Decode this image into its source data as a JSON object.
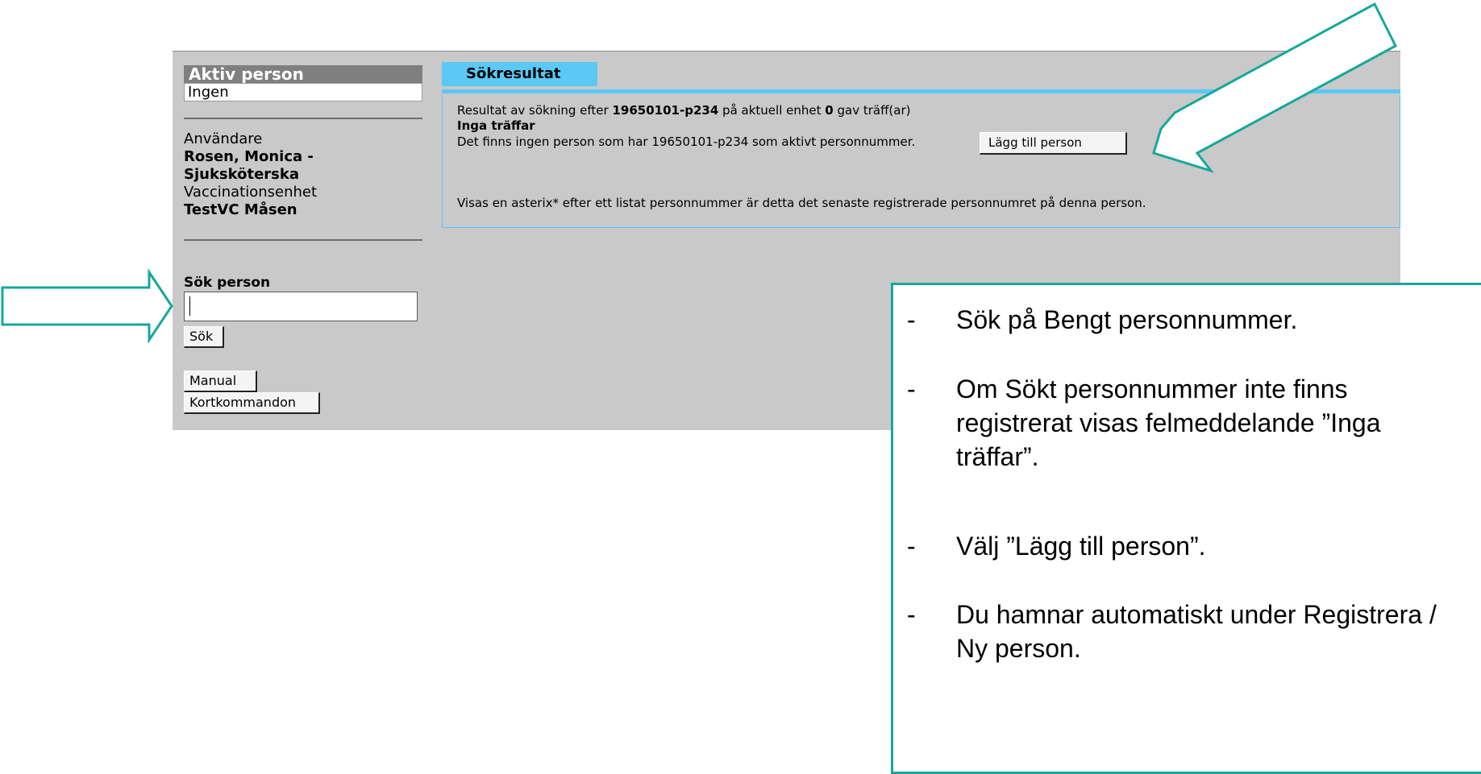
{
  "sidebar": {
    "active_header": "Aktiv person",
    "active_value": "Ingen",
    "user_label": "Användare",
    "user_name": "Rosen, Monica -",
    "user_role": "Sjuksköterska",
    "unit_label": "Vaccinationsenhet",
    "unit_name": "TestVC Måsen",
    "search_label": "Sök person",
    "search_value": "",
    "search_button": "Sök",
    "manual_button": "Manual",
    "shortcuts_button": "Kortkommandon"
  },
  "main": {
    "tab": "Sökresultat",
    "result_prefix": "Resultat av sökning efter",
    "query": "19650101-p234",
    "result_middle": "på aktuell enhet",
    "count": "0",
    "result_suffix": "gav träff(ar)",
    "no_hits": "Inga träffar",
    "no_person_text": "Det finns ingen person som har 19650101-p234 som aktivt personnummer.",
    "add_person_button": "Lägg till person",
    "asterisk_note": "Visas en asterix* efter ett listat personnummer är detta det senaste registrerade personnumret på denna person."
  },
  "instructions": [
    {
      "dash": "-",
      "text": "Sök på Bengt personnummer."
    },
    {
      "dash": "-",
      "text": "Om Sökt personnummer inte finns registrerat visas felmeddelande ”Inga träffar”."
    },
    {
      "dash": "-",
      "text": "Välj ”Lägg till person”."
    },
    {
      "dash": "-",
      "text": "Du hamnar automatiskt under Registrera / Ny person."
    }
  ],
  "colors": {
    "accent_blue": "#5bc8f5",
    "annotation_teal": "#17a79b",
    "panel_gray": "#c9c9c9"
  }
}
